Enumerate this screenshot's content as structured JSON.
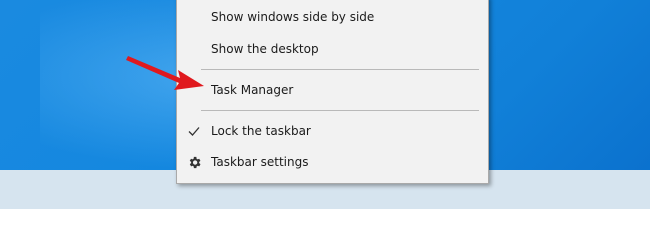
{
  "menu": {
    "items": [
      {
        "label": "Show windows side by side",
        "icon": ""
      },
      {
        "label": "Show the desktop",
        "icon": ""
      },
      {
        "label": "Task Manager",
        "icon": ""
      },
      {
        "label": "Lock the taskbar",
        "icon": "check-icon"
      },
      {
        "label": "Taskbar settings",
        "icon": "gear-icon"
      }
    ]
  },
  "colors": {
    "desktop": "#1487df",
    "taskbar": "#d6e4ef",
    "menu_bg": "#f2f2f2",
    "arrow": "#e0191e"
  }
}
